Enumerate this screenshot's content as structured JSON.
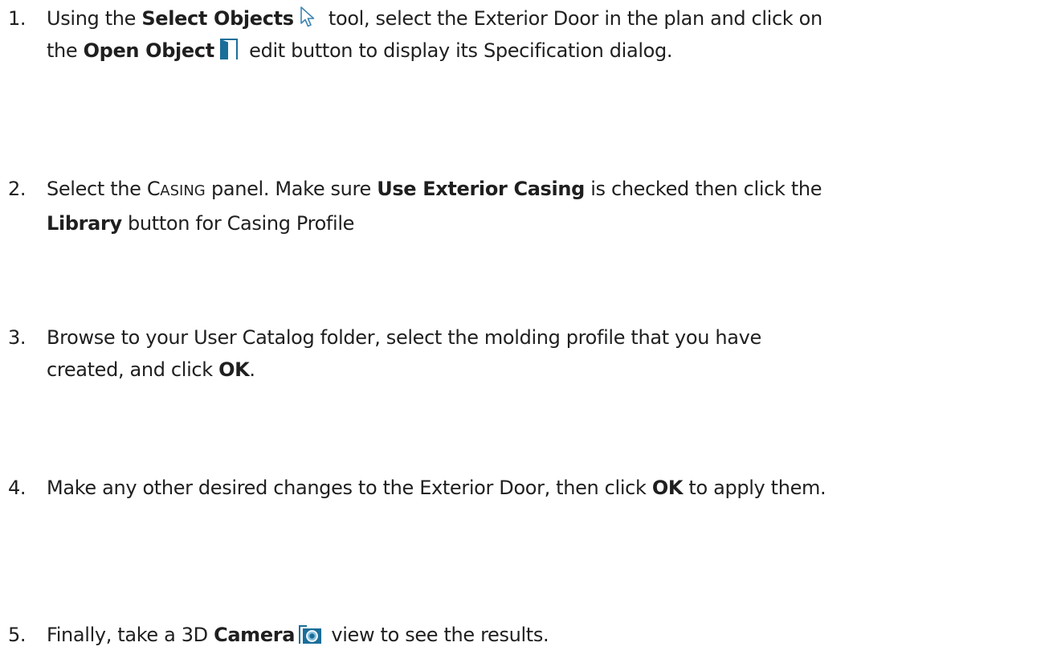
{
  "steps": [
    {
      "number": "1.",
      "line1": {
        "a": "Using the ",
        "tool_name": "Select Objects",
        "b": " tool, select the Exterior Door in the plan and click on"
      },
      "line2": {
        "a": "the ",
        "button_name": "Open Object",
        "b": " edit button to display its Specification dialog."
      },
      "icons": [
        "select-objects-arrow-icon",
        "open-object-door-icon"
      ]
    },
    {
      "number": "2.",
      "line1": {
        "a": "Select the ",
        "panel_cap": "C",
        "panel_rest": "ASING",
        "b": " panel. Make sure ",
        "option": "Use Exterior Casing",
        "c": " is checked then click the"
      },
      "line2": {
        "button_name": "Library",
        "b": " button for Casing Profile"
      }
    },
    {
      "number": "3.",
      "line1": {
        "a": "Browse to your User Catalog folder, select the molding profile that you have"
      },
      "line2": {
        "a": "created, and click ",
        "button_name": "OK",
        "b": "."
      }
    },
    {
      "number": "4.",
      "line1": {
        "a": "Make any other desired changes to the Exterior Door, then click ",
        "button_name": "OK",
        "b": " to apply them."
      }
    },
    {
      "number": "5.",
      "line1": {
        "a": "Finally, take a 3D ",
        "tool_name": "Camera",
        "b": " view to see the results."
      },
      "icons": [
        "camera-icon"
      ]
    }
  ],
  "colors": {
    "text": "#1f1f1f",
    "icon_blue": "#1a6e9a",
    "icon_light_blue": "#8cc3df"
  }
}
